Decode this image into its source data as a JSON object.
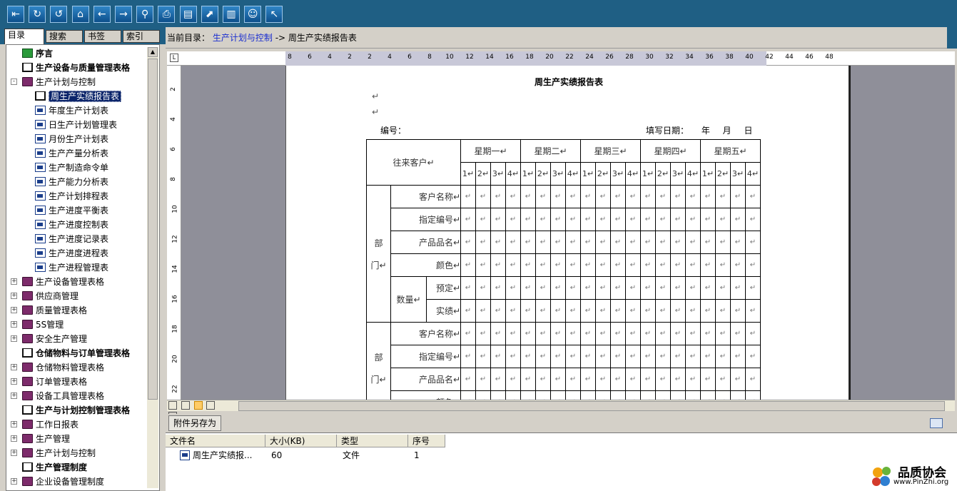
{
  "toolbar": {
    "buttons": [
      "exit",
      "refresh",
      "back-nav",
      "home",
      "prev",
      "next",
      "search",
      "print",
      "notes",
      "export",
      "copy",
      "smile",
      "pointer"
    ]
  },
  "left_tabs": [
    "目录",
    "搜索",
    "书签",
    "索引"
  ],
  "tree": [
    {
      "label": "序言",
      "icon": "green-doc",
      "bold": true,
      "depth": 1
    },
    {
      "label": "生产设备与质量管理表格",
      "icon": "open-book",
      "bold": true,
      "depth": 1
    },
    {
      "label": "生产计划与控制",
      "icon": "book",
      "bold": false,
      "depth": 0,
      "expander": "-"
    },
    {
      "label": "周生产实绩报告表",
      "icon": "open-book",
      "bold": false,
      "depth": 2,
      "selected": true
    },
    {
      "label": "年度生产计划表",
      "icon": "doc",
      "bold": false,
      "depth": 2
    },
    {
      "label": "日生产计划管理表",
      "icon": "doc",
      "bold": false,
      "depth": 2
    },
    {
      "label": "月份生产计划表",
      "icon": "doc",
      "bold": false,
      "depth": 2
    },
    {
      "label": "生产产量分析表",
      "icon": "doc",
      "bold": false,
      "depth": 2
    },
    {
      "label": "生产制造命令单",
      "icon": "doc",
      "bold": false,
      "depth": 2
    },
    {
      "label": "生产能力分析表",
      "icon": "doc",
      "bold": false,
      "depth": 2
    },
    {
      "label": "生产计划排程表",
      "icon": "doc",
      "bold": false,
      "depth": 2
    },
    {
      "label": "生产进度平衡表",
      "icon": "doc",
      "bold": false,
      "depth": 2
    },
    {
      "label": "生产进度控制表",
      "icon": "doc",
      "bold": false,
      "depth": 2
    },
    {
      "label": "生产进度记录表",
      "icon": "doc",
      "bold": false,
      "depth": 2
    },
    {
      "label": "生产进度进程表",
      "icon": "doc",
      "bold": false,
      "depth": 2
    },
    {
      "label": "生产进程管理表",
      "icon": "doc",
      "bold": false,
      "depth": 2
    },
    {
      "label": "生产设备管理表格",
      "icon": "book",
      "bold": false,
      "depth": 0,
      "expander": "+"
    },
    {
      "label": "供应商管理",
      "icon": "book",
      "bold": false,
      "depth": 0,
      "expander": "+"
    },
    {
      "label": "质量管理表格",
      "icon": "book",
      "bold": false,
      "depth": 0,
      "expander": "+"
    },
    {
      "label": "5S管理",
      "icon": "book",
      "bold": false,
      "depth": 0,
      "expander": "+"
    },
    {
      "label": "安全生产管理",
      "icon": "book",
      "bold": false,
      "depth": 0,
      "expander": "+"
    },
    {
      "label": "仓储物料与订单管理表格",
      "icon": "open-book",
      "bold": true,
      "depth": 1
    },
    {
      "label": "仓储物料管理表格",
      "icon": "book",
      "bold": false,
      "depth": 0,
      "expander": "+"
    },
    {
      "label": "订单管理表格",
      "icon": "book",
      "bold": false,
      "depth": 0,
      "expander": "+"
    },
    {
      "label": "设备工具管理表格",
      "icon": "book",
      "bold": false,
      "depth": 0,
      "expander": "+"
    },
    {
      "label": "生产与计划控制管理表格",
      "icon": "open-book",
      "bold": true,
      "depth": 1
    },
    {
      "label": "工作日报表",
      "icon": "book",
      "bold": false,
      "depth": 0,
      "expander": "+"
    },
    {
      "label": "生产管理",
      "icon": "book",
      "bold": false,
      "depth": 0,
      "expander": "+"
    },
    {
      "label": "生产计划与控制",
      "icon": "book",
      "bold": false,
      "depth": 0,
      "expander": "+"
    },
    {
      "label": "生产管理制度",
      "icon": "open-book",
      "bold": true,
      "depth": 1
    },
    {
      "label": "企业设备管理制度",
      "icon": "book",
      "bold": false,
      "depth": 0,
      "expander": "+"
    }
  ],
  "breadcrumb": {
    "prefix": "当前目录：",
    "link": "生产计划与控制",
    "arrow": "->",
    "current": "周生产实绩报告表"
  },
  "ruler": {
    "h_ticks": [
      "8",
      "6",
      "4",
      "2",
      "2",
      "4",
      "6",
      "8",
      "10",
      "12",
      "14",
      "16",
      "18",
      "20",
      "22",
      "24",
      "26",
      "28",
      "30",
      "32",
      "34",
      "36",
      "38",
      "40",
      "42",
      "44",
      "46",
      "48"
    ],
    "v_ticks": [
      "2",
      "4",
      "6",
      "8",
      "10",
      "12",
      "14",
      "16",
      "18",
      "20",
      "22"
    ]
  },
  "document": {
    "title": "周生产实绩报告表",
    "return_mark": "↵",
    "number_label": "编号：",
    "date_label": "填写日期：  年  月  日",
    "customer_header": "往来客户",
    "weekdays": [
      "星期一",
      "星期二",
      "星期三",
      "星期四",
      "星期五"
    ],
    "sub_cols": [
      "1",
      "2",
      "3",
      "4"
    ],
    "dept_chars": [
      "部",
      "门"
    ],
    "row_labels": [
      "客户名称",
      "指定编号",
      "产品品名",
      "颜色"
    ],
    "quantity_label": "数量",
    "quantity_subs": [
      "预定",
      "实绩"
    ]
  },
  "attachments": {
    "save_button": "附件另存为",
    "columns": [
      "文件名",
      "大小(KB)",
      "类型",
      "序号"
    ],
    "rows": [
      {
        "name": "周生产实绩报...",
        "size": "60",
        "type": "文件",
        "index": "1"
      }
    ]
  },
  "logo": {
    "name": "品质协会",
    "url": "www.PinZhi.org"
  }
}
